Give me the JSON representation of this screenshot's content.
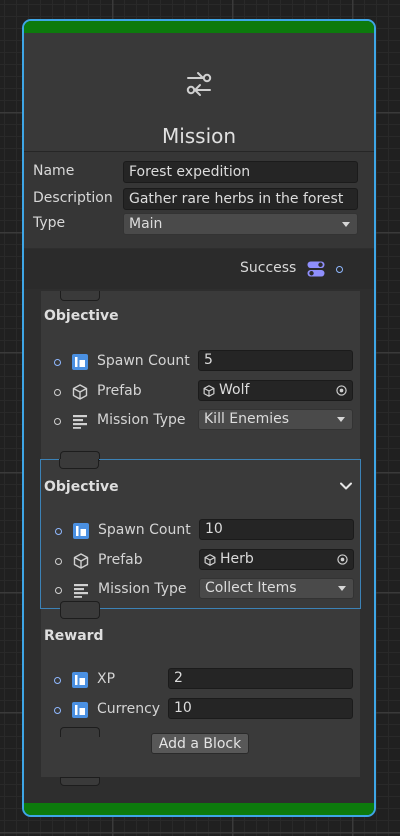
{
  "node": {
    "title": "Mission",
    "header_icon": "switch-icon",
    "fields": [
      {
        "label": "Name",
        "value": "Forest expedition"
      },
      {
        "label": "Description",
        "value": "Gather rare herbs in the forest"
      },
      {
        "label": "Type",
        "value": "Main"
      }
    ],
    "output_label": "Success"
  },
  "blocks": [
    {
      "title": "Objective",
      "rows": [
        {
          "label": "Spawn Count",
          "value": "5",
          "icon": "int-icon"
        },
        {
          "label": "Prefab",
          "value": "Wolf",
          "icon": "cube-icon"
        },
        {
          "label": "Mission Type",
          "value": "Kill Enemies",
          "icon": "enum-icon"
        }
      ]
    },
    {
      "title": "Objective",
      "rows": [
        {
          "label": "Spawn Count",
          "value": "10",
          "icon": "int-icon"
        },
        {
          "label": "Prefab",
          "value": "Herb",
          "icon": "cube-icon"
        },
        {
          "label": "Mission Type",
          "value": "Collect Items",
          "icon": "enum-icon"
        }
      ]
    },
    {
      "title": "Reward",
      "rows": [
        {
          "label": "XP",
          "value": "2",
          "icon": "int-icon"
        },
        {
          "label": "Currency",
          "value": "10",
          "icon": "int-icon"
        }
      ]
    }
  ],
  "add_block_label": "Add a Block",
  "colors": {
    "selection_border": "#3ea6e6",
    "header_stripe": "#0d7a0d",
    "port_blue": "#8fb8ff",
    "int_icon": "#4a90e2"
  }
}
